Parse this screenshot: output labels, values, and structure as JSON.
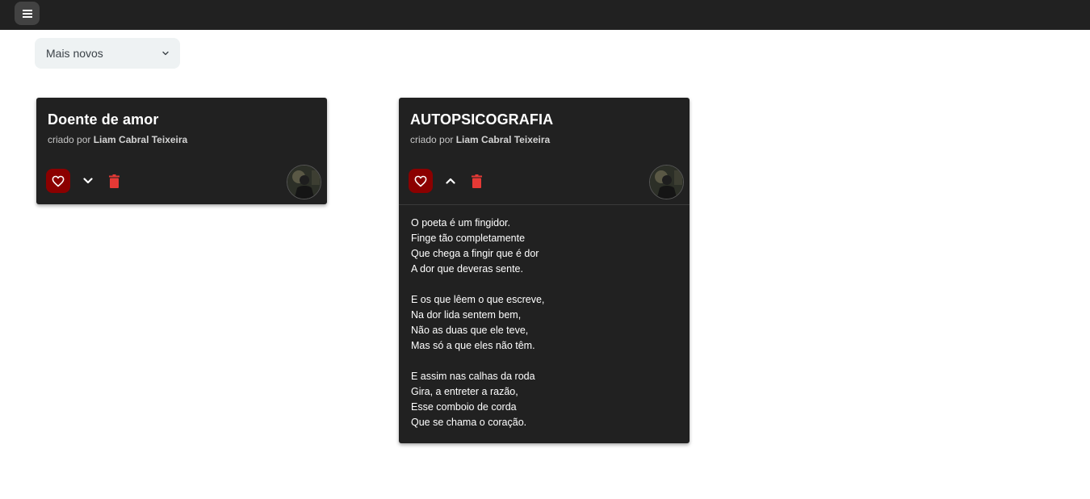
{
  "topbar": {
    "menu_icon": "hamburger-menu-icon"
  },
  "sort": {
    "selected": "Mais novos",
    "icon": "chevron-down-icon"
  },
  "colors": {
    "topbar": "#212121",
    "card": "#212121",
    "like_bg": "#8b0000",
    "delete": "#e53935",
    "select_bg": "#eef2f3"
  },
  "posts": [
    {
      "title": "Doente de amor",
      "by_label": "criado por",
      "author": "Liam Cabral Teixeira",
      "like_icon": "heart-outline-icon",
      "toggle_icon": "chevron-down-icon",
      "delete_icon": "trash-icon",
      "expanded": false
    },
    {
      "title": "AUTOPSICOGRAFIA",
      "by_label": "criado por",
      "author": "Liam Cabral Teixeira",
      "like_icon": "heart-outline-icon",
      "toggle_icon": "chevron-up-icon",
      "delete_icon": "trash-icon",
      "expanded": true,
      "stanzas": [
        [
          "O poeta é um fingidor.",
          "Finge tão completamente",
          "Que chega a fingir que é dor",
          "A dor que deveras sente."
        ],
        [
          "E os que lêem o que escreve,",
          "Na dor lida sentem bem,",
          "Não as duas que ele teve,",
          "Mas só a que eles não têm."
        ],
        [
          "E assim nas calhas da roda",
          "Gira, a entreter a razão,",
          "Esse comboio de corda",
          "Que se chama o coração."
        ]
      ]
    }
  ]
}
